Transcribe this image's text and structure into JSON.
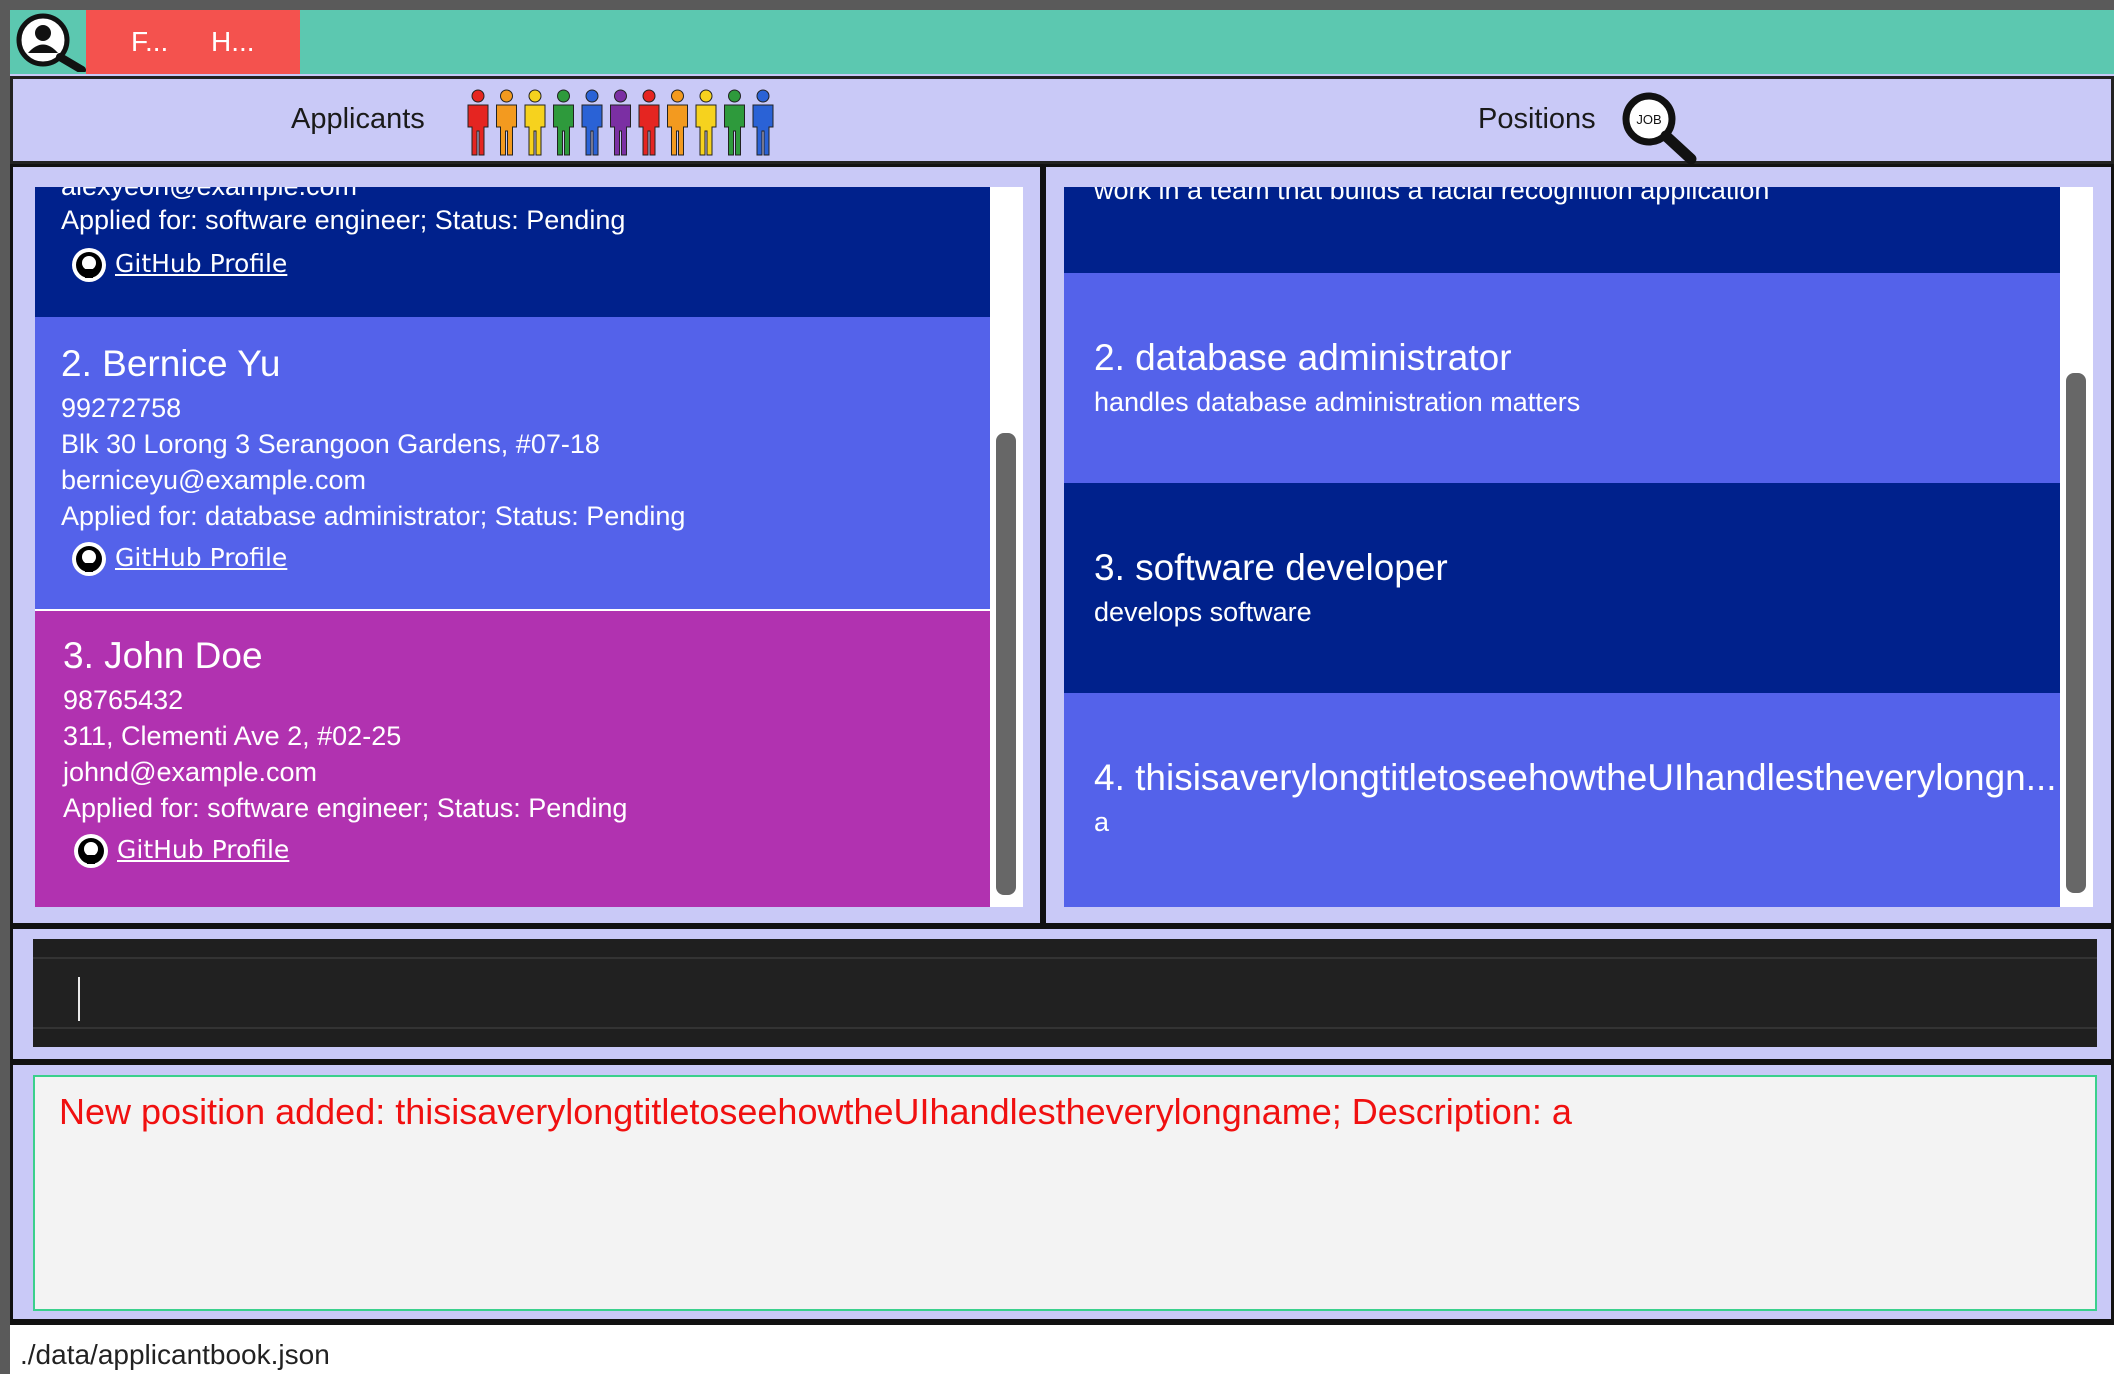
{
  "menu": {
    "file": "F...",
    "help": "H..."
  },
  "header": {
    "applicants": "Applicants",
    "positions": "Positions",
    "job_icon_text": "JOB"
  },
  "applicants": [
    {
      "email": "alexyeoh@example.com",
      "applied": "Applied for: software engineer; Status: Pending",
      "github": "GitHub Profile",
      "color": "#00218c"
    },
    {
      "name": "2.  Bernice Yu",
      "phone": "99272758",
      "address": "Blk 30 Lorong 3 Serangoon Gardens, #07-18",
      "email": "berniceyu@example.com",
      "applied": "Applied for: database administrator; Status: Pending",
      "github": "GitHub Profile",
      "color": "#5462ea"
    },
    {
      "name": "3.  John Doe",
      "phone": "98765432",
      "address": "311, Clementi Ave 2, #02-25",
      "email": "johnd@example.com",
      "applied": "Applied for: software engineer; Status: Pending",
      "github": "GitHub Profile",
      "color": "#b132b0"
    }
  ],
  "positions": [
    {
      "description": "work in a team that builds a facial recognition application",
      "color": "#00218c"
    },
    {
      "title": "2.  database administrator",
      "description": "handles database administration matters",
      "color": "#5462ea"
    },
    {
      "title": "3.  software developer",
      "description": "develops software",
      "color": "#00218c"
    },
    {
      "title": "4.  thisisaverylongtitletoseehowtheUIhandlestheverylongn...",
      "description": "a",
      "color": "#5462ea"
    }
  ],
  "command": {
    "value": ""
  },
  "result": {
    "message": "New position added: thisisaverylongtitletoseehowtheUIhandlestheverylongname; Description: a"
  },
  "status": {
    "path": "./data/applicantbook.json"
  },
  "colors": {
    "topbar": "#5cc8b0",
    "menubar": "#f4524e",
    "background": "#c9c9f7",
    "result_text": "#f01010"
  }
}
